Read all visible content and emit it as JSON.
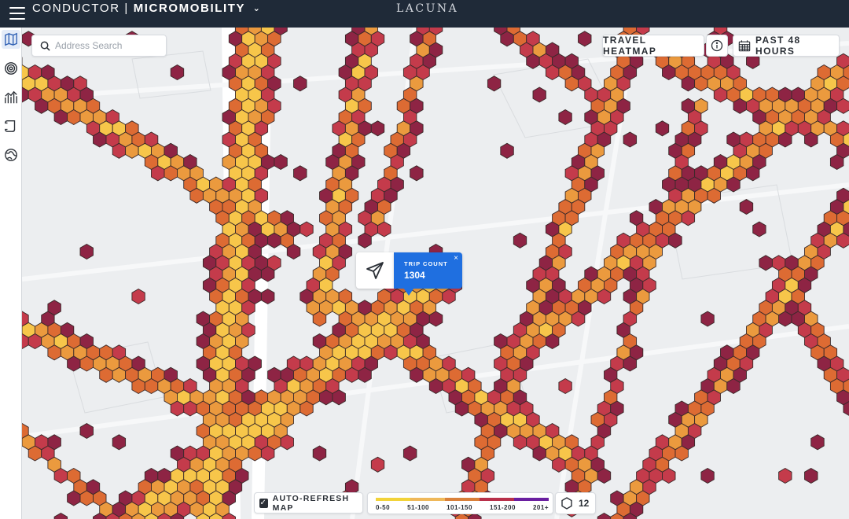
{
  "header": {
    "app_name": "CONDUCTOR",
    "separator": "|",
    "module": "MICROMOBILITY",
    "brand": "LACUNA"
  },
  "sidebar": {
    "items": [
      {
        "icon": "map-icon",
        "active": true
      },
      {
        "icon": "target-icon",
        "active": false
      },
      {
        "icon": "analytics-icon",
        "active": false
      },
      {
        "icon": "scroll-icon",
        "active": false
      },
      {
        "icon": "globe-icon",
        "active": false
      }
    ]
  },
  "search": {
    "placeholder": "Address Search"
  },
  "map_controls": {
    "layer_label": "TRAVEL HEATMAP",
    "time_label": "PAST 48 HOURS"
  },
  "popup": {
    "label": "TRIP COUNT",
    "value": "1304",
    "close": "×"
  },
  "footer": {
    "auto_refresh_label": "AUTO-REFRESH MAP",
    "auto_refresh_checked": true,
    "checkmark": "✓",
    "legend": [
      {
        "label": "0-50",
        "color": "#f2d33a"
      },
      {
        "label": "51-100",
        "color": "#efb85a"
      },
      {
        "label": "101-150",
        "color": "#d9803a"
      },
      {
        "label": "151-200",
        "color": "#b8304a"
      },
      {
        "label": "201+",
        "color": "#6a1fa0"
      }
    ],
    "hex_size": "12"
  },
  "colors": {
    "yellow": "#f7c64a",
    "orange": "#eb9a3e",
    "dark_orange": "#dd6b33",
    "red": "#c43b4b",
    "maroon": "#8e2444",
    "accent": "#1f6fe0"
  }
}
